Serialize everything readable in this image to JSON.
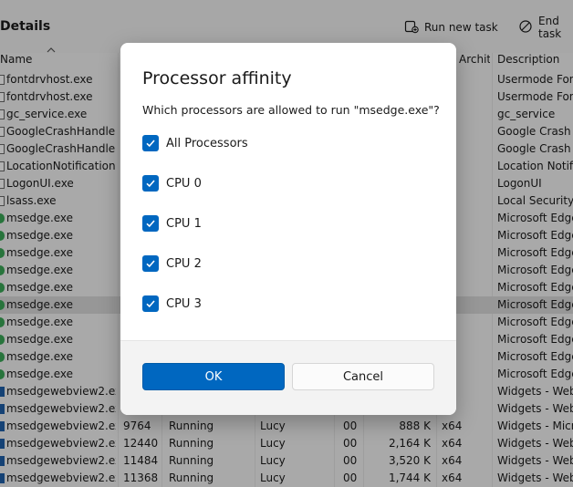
{
  "header": {
    "title": "Details",
    "run_new_task": "Run new task",
    "end_task": "End task"
  },
  "columns": {
    "name": "Name",
    "architecture": "Archite...",
    "description": "Description"
  },
  "rows": [
    {
      "name": "fontdrvhost.exe",
      "pid": "",
      "status": "",
      "user": "",
      "cpu": "",
      "mem": "",
      "arch": "4",
      "desc": "Usermode Font",
      "icon": "file"
    },
    {
      "name": "fontdrvhost.exe",
      "pid": "",
      "status": "",
      "user": "",
      "cpu": "",
      "mem": "",
      "arch": "4",
      "desc": "Usermode Font",
      "icon": "file"
    },
    {
      "name": "gc_service.exe",
      "pid": "",
      "status": "",
      "user": "",
      "cpu": "",
      "mem": "",
      "arch": "4",
      "desc": "gc_service",
      "icon": "file"
    },
    {
      "name": "GoogleCrashHandler...",
      "pid": "",
      "status": "",
      "user": "",
      "cpu": "",
      "mem": "",
      "arch": "6",
      "desc": "Google Crash H",
      "icon": "google"
    },
    {
      "name": "GoogleCrashHandler...",
      "pid": "",
      "status": "",
      "user": "",
      "cpu": "",
      "mem": "",
      "arch": "4",
      "desc": "Google Crash H",
      "icon": "google"
    },
    {
      "name": "LocationNotification...",
      "pid": "",
      "status": "",
      "user": "",
      "cpu": "",
      "mem": "",
      "arch": "4",
      "desc": "Location Notific",
      "icon": "file"
    },
    {
      "name": "LogonUI.exe",
      "pid": "",
      "status": "",
      "user": "",
      "cpu": "",
      "mem": "",
      "arch": "4",
      "desc": "LogonUI",
      "icon": "file"
    },
    {
      "name": "lsass.exe",
      "pid": "",
      "status": "",
      "user": "",
      "cpu": "",
      "mem": "",
      "arch": "4",
      "desc": "Local Security A",
      "icon": "file"
    },
    {
      "name": "msedge.exe",
      "pid": "",
      "status": "",
      "user": "",
      "cpu": "",
      "mem": "",
      "arch": "4",
      "desc": "Microsoft Edge",
      "icon": "edge"
    },
    {
      "name": "msedge.exe",
      "pid": "",
      "status": "",
      "user": "",
      "cpu": "",
      "mem": "",
      "arch": "4",
      "desc": "Microsoft Edge",
      "icon": "edge"
    },
    {
      "name": "msedge.exe",
      "pid": "",
      "status": "",
      "user": "",
      "cpu": "",
      "mem": "",
      "arch": "4",
      "desc": "Microsoft Edge",
      "icon": "edge"
    },
    {
      "name": "msedge.exe",
      "pid": "",
      "status": "",
      "user": "",
      "cpu": "",
      "mem": "",
      "arch": "4",
      "desc": "Microsoft Edge",
      "icon": "edge"
    },
    {
      "name": "msedge.exe",
      "pid": "",
      "status": "",
      "user": "",
      "cpu": "",
      "mem": "",
      "arch": "4",
      "desc": "Microsoft Edge",
      "icon": "edge"
    },
    {
      "name": "msedge.exe",
      "pid": "",
      "status": "",
      "user": "",
      "cpu": "",
      "mem": "",
      "arch": "4",
      "desc": "Microsoft Edge",
      "icon": "edge",
      "selected": true
    },
    {
      "name": "msedge.exe",
      "pid": "",
      "status": "",
      "user": "",
      "cpu": "",
      "mem": "",
      "arch": "4",
      "desc": "Microsoft Edge",
      "icon": "edge"
    },
    {
      "name": "msedge.exe",
      "pid": "",
      "status": "",
      "user": "",
      "cpu": "",
      "mem": "",
      "arch": "4",
      "desc": "Microsoft Edge",
      "icon": "edge"
    },
    {
      "name": "msedge.exe",
      "pid": "",
      "status": "",
      "user": "",
      "cpu": "",
      "mem": "",
      "arch": "4",
      "desc": "Microsoft Edge",
      "icon": "edge"
    },
    {
      "name": "msedge.exe",
      "pid": "",
      "status": "",
      "user": "",
      "cpu": "",
      "mem": "",
      "arch": "4",
      "desc": "Microsoft Edge",
      "icon": "edge"
    },
    {
      "name": "msedgewebview2.exe",
      "pid": "",
      "status": "",
      "user": "",
      "cpu": "",
      "mem": "",
      "arch": "4",
      "desc": "Widgets - WebV",
      "icon": "webview"
    },
    {
      "name": "msedgewebview2.exe",
      "pid": "",
      "status": "",
      "user": "",
      "cpu": "",
      "mem": "",
      "arch": "4",
      "desc": "Widgets - WebV",
      "icon": "webview"
    },
    {
      "name": "msedgewebview2.exe",
      "pid": "9764",
      "status": "Running",
      "user": "Lucy",
      "cpu": "00",
      "mem": "888 K",
      "arch": "x64",
      "desc": "Widgets - Micro",
      "icon": "webview"
    },
    {
      "name": "msedgewebview2.exe",
      "pid": "12440",
      "status": "Running",
      "user": "Lucy",
      "cpu": "00",
      "mem": "2,164 K",
      "arch": "x64",
      "desc": "Widgets - WebV",
      "icon": "webview"
    },
    {
      "name": "msedgewebview2.exe",
      "pid": "11484",
      "status": "Running",
      "user": "Lucy",
      "cpu": "00",
      "mem": "3,520 K",
      "arch": "x64",
      "desc": "Widgets - WebV",
      "icon": "webview"
    },
    {
      "name": "msedgewebview2.exe",
      "pid": "11368",
      "status": "Running",
      "user": "Lucy",
      "cpu": "00",
      "mem": "1,744 K",
      "arch": "x64",
      "desc": "Widgets - WebV",
      "icon": "webview"
    }
  ],
  "dialog": {
    "title": "Processor affinity",
    "prompt": "Which processors are allowed to run \"msedge.exe\"?",
    "options": [
      {
        "label": "All Processors",
        "checked": true
      },
      {
        "label": "CPU 0",
        "checked": true
      },
      {
        "label": "CPU 1",
        "checked": true
      },
      {
        "label": "CPU 2",
        "checked": true
      },
      {
        "label": "CPU 3",
        "checked": true
      }
    ],
    "ok_label": "OK",
    "cancel_label": "Cancel"
  },
  "colors": {
    "accent": "#0067c0",
    "edge_icon": "#3aa757",
    "webview_icon": "#1f5fa8",
    "file_icon": "#6b6b6b"
  }
}
